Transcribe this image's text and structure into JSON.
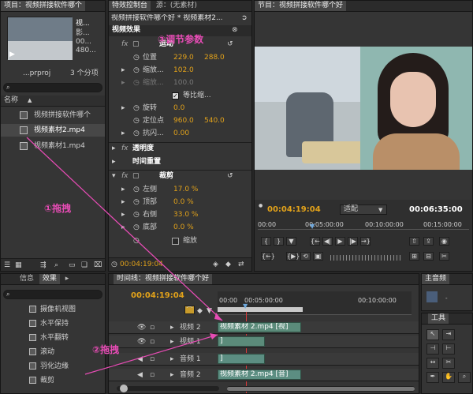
{
  "project": {
    "tab": "项目：视频拼接软件哪个",
    "preview": {
      "name": "视...",
      "line2": "影...",
      "line3": "00...",
      "line4": "480..."
    },
    "file_name": "...prproj",
    "item_count": "3 个分项",
    "col_header": "名称",
    "items": [
      "视频拼接软件哪个",
      "视频素材2.mp4",
      "视频素材1.mp4"
    ]
  },
  "effects_panel": {
    "tabs": [
      "信息",
      "效果",
      "▸"
    ],
    "items": [
      "摄像机视图",
      "水平保持",
      "水平翻转",
      "滚动",
      "羽化边缘",
      "裁剪"
    ]
  },
  "effect_controls": {
    "tabs": [
      "特效控制台",
      "源：(无素材)"
    ],
    "seq_title": "视频拼接软件哪个好 * 视频素材2...",
    "header": "视频效果",
    "motion": "运动",
    "props": [
      {
        "name": "位置",
        "v1": "229.0",
        "v2": "288.0"
      },
      {
        "name": "缩放...",
        "v1": "102.0"
      },
      {
        "name": "缩放...",
        "v1": "100.0"
      },
      {
        "name": "旋转",
        "v1": "0.0"
      },
      {
        "name": "定位点",
        "v1": "960.0",
        "v2": "540.0"
      },
      {
        "name": "抗闪...",
        "v1": "0.00"
      }
    ],
    "uniform": "等比缩...",
    "opacity": "透明度",
    "time_remap": "时间重置",
    "crop": "裁剪",
    "crop_props": [
      {
        "name": "左侧",
        "v": "17.0 %"
      },
      {
        "name": "顶部",
        "v": "0.0 %"
      },
      {
        "name": "右侧",
        "v": "33.0 %"
      },
      {
        "name": "底部",
        "v": "0.0 %"
      }
    ],
    "zoom": "缩放",
    "timecode": "00:04:19:04"
  },
  "program": {
    "tab": "节目：视频拼接软件哪个好",
    "timecode": "00:04:19:04",
    "fit": "适配",
    "duration": "00:06:35:00",
    "ruler": [
      "00:00",
      "00:05:00:00",
      "00:10:00:00",
      "00:15:00:00"
    ]
  },
  "timeline": {
    "tab": "时间线：视频拼接软件哪个好",
    "timecode": "00:04:19:04",
    "ruler": [
      "00:00",
      "00:05:00:00",
      "00:10:00:00"
    ],
    "tracks": [
      "视频 2",
      "视频 1",
      "音频 1",
      "音频 2"
    ],
    "clip_v2": "视频素材 2.mp4 [视]",
    "clip_a2": "视频素材 2.mp4 [音]",
    "bracket": "]"
  },
  "master": {
    "tab": "主音频"
  },
  "tools": {
    "tab": "工具"
  },
  "annotations": {
    "a1": "①拖拽",
    "a2": "②拖拽",
    "a3": "③调节参数"
  },
  "colors": {
    "accent": "#e2a21a",
    "annotation": "#e74cb5",
    "clip": "#5b8b7a",
    "panel": "#353535"
  }
}
